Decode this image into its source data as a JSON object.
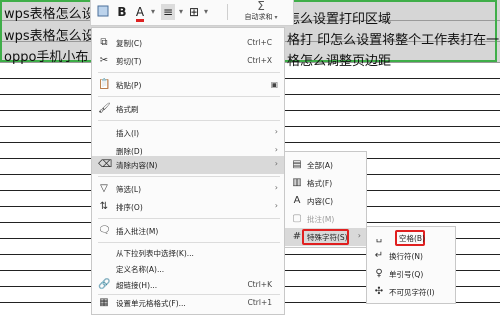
{
  "sheet": {
    "rows": [
      {
        "left": "wps表格怎么设置",
        "right": "怎么设置打印区域"
      },
      {
        "left": "wps表格怎么设置",
        "right": "格打 印怎么设置将整个工作表打在一页"
      },
      {
        "left": "oppo手机小布 的",
        "right": "格怎么调整页边距"
      }
    ]
  },
  "toolbar": {
    "bold": "B",
    "font_color": "A",
    "align": "≡",
    "borders": "⊞",
    "autosum": "自动求和"
  },
  "context_menu": {
    "items": [
      {
        "icon": "copy-icon",
        "label": "复制(C)",
        "shortcut": "Ctrl+C"
      },
      {
        "icon": "cut-icon",
        "label": "剪切(T)",
        "shortcut": "Ctrl+X"
      },
      {
        "icon": "paste-icon",
        "label": "粘贴(P)"
      },
      {
        "icon": "format-painter-icon",
        "label": "格式刷"
      },
      {
        "icon": "",
        "label": "插入(I)"
      },
      {
        "icon": "",
        "label": "删除(D)"
      },
      {
        "icon": "eraser-icon",
        "label": "清除内容(N)"
      },
      {
        "icon": "filter-icon",
        "label": "筛选(L)"
      },
      {
        "icon": "sort-icon",
        "label": "排序(O)"
      },
      {
        "icon": "comment-icon",
        "label": "插入批注(M)"
      },
      {
        "icon": "",
        "label": "从下拉列表中选择(K)..."
      },
      {
        "icon": "",
        "label": "定义名称(A)..."
      },
      {
        "icon": "link-icon",
        "label": "超链接(H)...",
        "shortcut": "Ctrl+K"
      },
      {
        "icon": "format-cells-icon",
        "label": "设置单元格格式(F)...",
        "shortcut": "Ctrl+1"
      }
    ]
  },
  "clear_submenu": {
    "items": [
      {
        "icon": "clear-all-icon",
        "label": "全部(A)"
      },
      {
        "icon": "clear-format-icon",
        "label": "格式(F)"
      },
      {
        "icon": "clear-content-icon",
        "label": "内容(C)"
      },
      {
        "icon": "clear-comment-icon",
        "label": "批注(M)",
        "disabled": true
      },
      {
        "icon": "special-chars-icon",
        "label": "特殊字符(S)"
      }
    ]
  },
  "special_submenu": {
    "items": [
      {
        "icon": "space-icon",
        "label": "空格(B)"
      },
      {
        "icon": "line-break-icon",
        "label": "换行符(N)"
      },
      {
        "icon": "quote-icon",
        "label": "单引号(Q)"
      },
      {
        "icon": "invisible-char-icon",
        "label": "不可见字符(I)"
      }
    ]
  },
  "colors": {
    "selection_border": "#3fae49",
    "highlight_box": "#e02020",
    "menu_highlight": "#d9d9d9"
  }
}
